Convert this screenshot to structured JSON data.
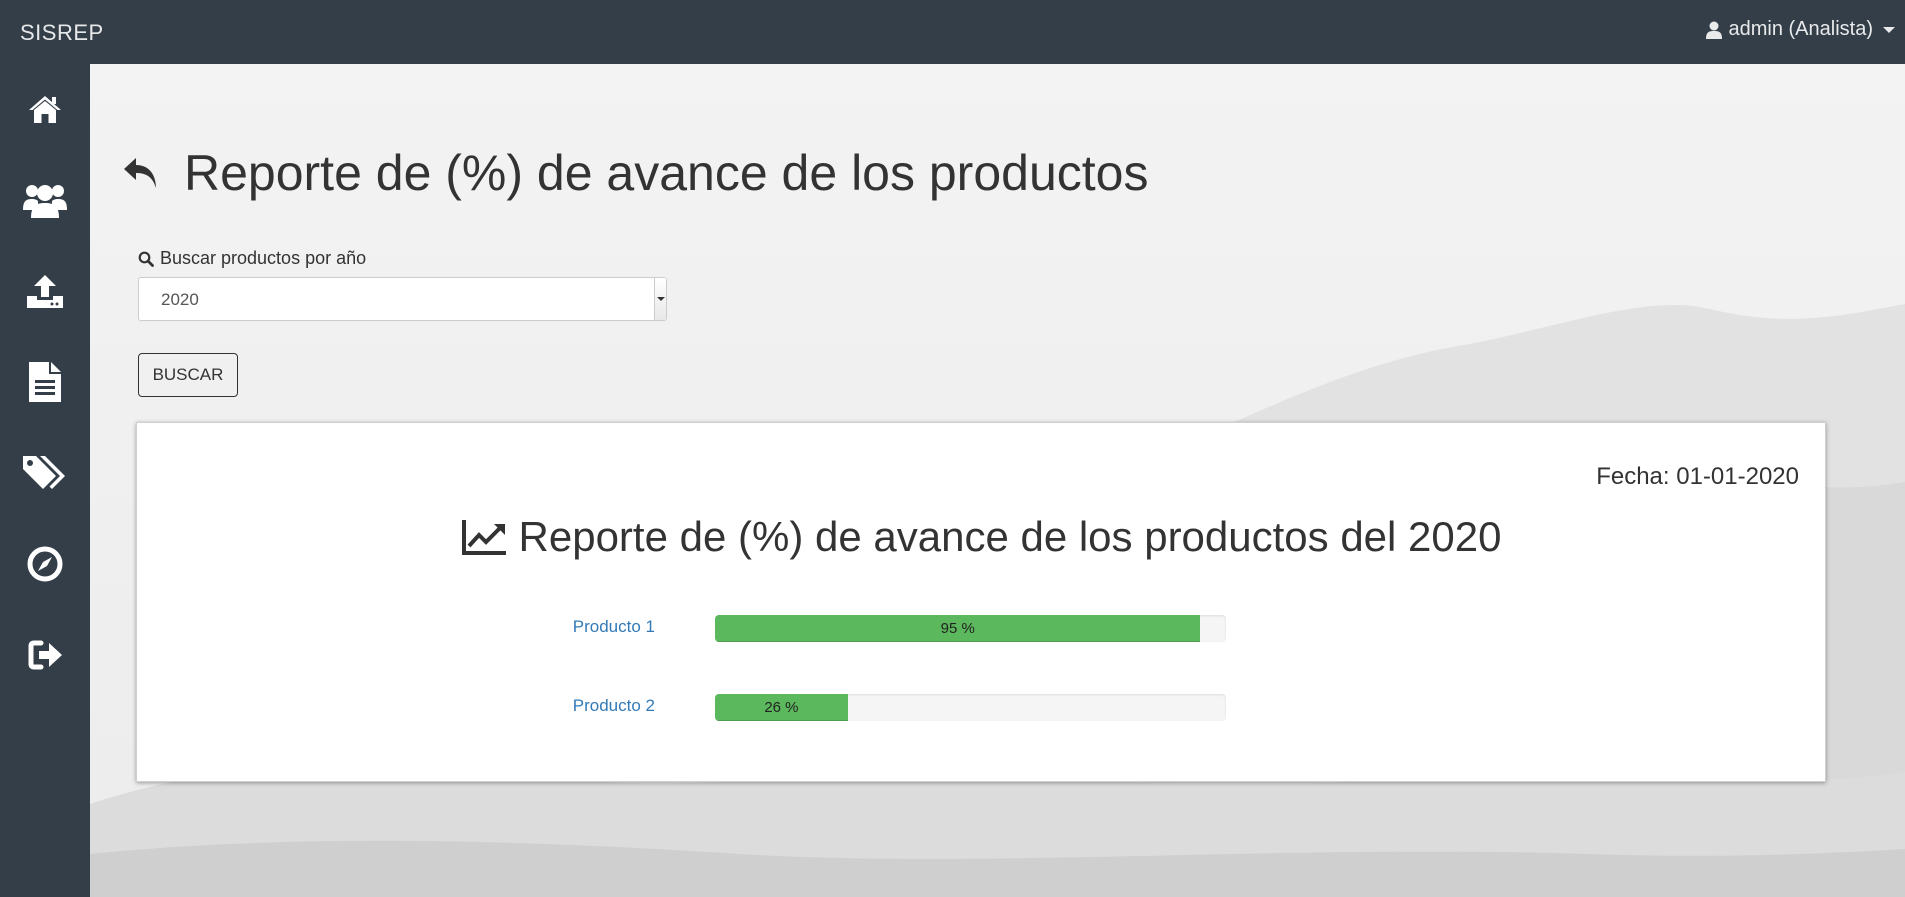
{
  "app": {
    "brand": "SISREP"
  },
  "user": {
    "label": "admin (Analista)"
  },
  "sidebar": {
    "items": [
      {
        "icon": "home-icon"
      },
      {
        "icon": "users-icon"
      },
      {
        "icon": "upload-icon"
      },
      {
        "icon": "document-icon"
      },
      {
        "icon": "tags-icon"
      },
      {
        "icon": "compass-icon"
      },
      {
        "icon": "logout-icon"
      }
    ]
  },
  "page": {
    "title": "Reporte de (%) de avance de los productos",
    "search_label": "Buscar productos por año",
    "year_selected": "2020",
    "search_button": "BUSCAR"
  },
  "report": {
    "date": "Fecha: 01-01-2020",
    "title": "Reporte de (%) de avance de los productos del 2020",
    "products": [
      {
        "name": "Producto 1",
        "percent": 95,
        "label": "95 %"
      },
      {
        "name": "Producto 2",
        "percent": 26,
        "label": "26 %"
      }
    ]
  },
  "colors": {
    "navbar": "#343e48",
    "progress": "#5cb85c",
    "link": "#337ab7"
  }
}
